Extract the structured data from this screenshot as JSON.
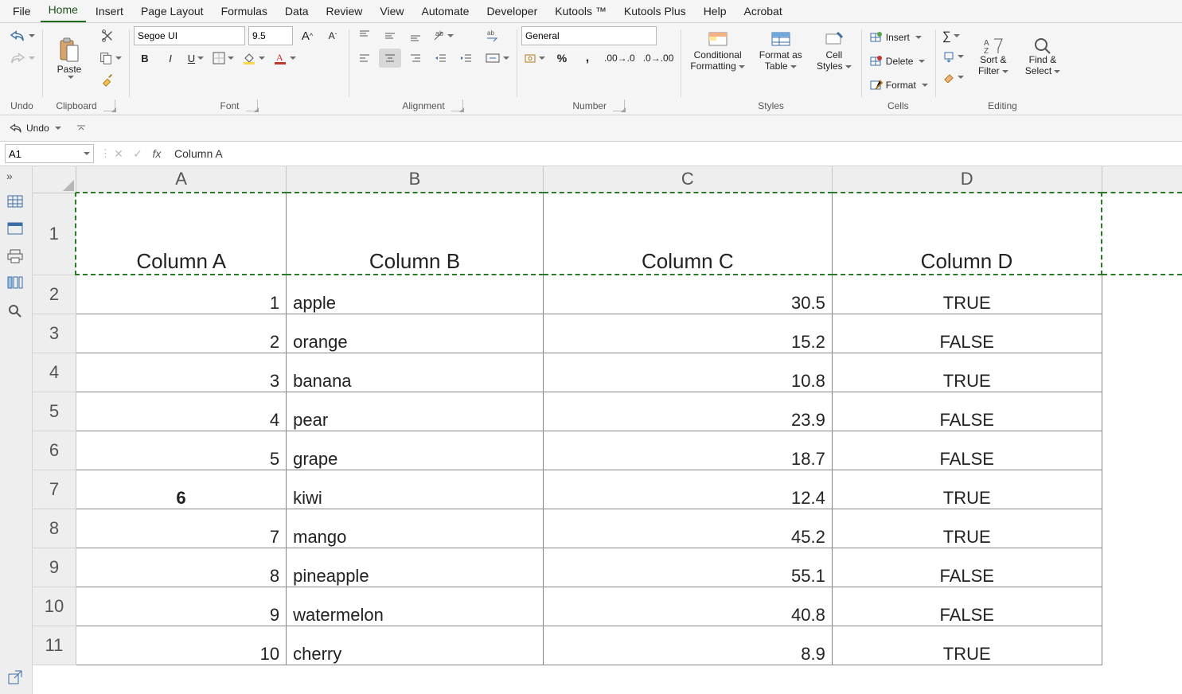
{
  "tabs": {
    "items": [
      "File",
      "Home",
      "Insert",
      "Page Layout",
      "Formulas",
      "Data",
      "Review",
      "View",
      "Automate",
      "Developer",
      "Kutools ™",
      "Kutools Plus",
      "Help",
      "Acrobat"
    ],
    "active_index": 1
  },
  "ribbon": {
    "undo_group": "Undo",
    "clipboard_group": "Clipboard",
    "paste_label": "Paste",
    "font_group": "Font",
    "font_name": "Segoe UI",
    "font_size": "9.5",
    "alignment_group": "Alignment",
    "number_group": "Number",
    "number_format": "General",
    "styles_group": "Styles",
    "conditional_label_1": "Conditional",
    "conditional_label_2": "Formatting",
    "format_as_label_1": "Format as",
    "format_as_label_2": "Table",
    "cell_styles_label_1": "Cell",
    "cell_styles_label_2": "Styles",
    "cells_group": "Cells",
    "insert_label": "Insert",
    "delete_label": "Delete",
    "format_label": "Format",
    "editing_group": "Editing",
    "sort_label_1": "Sort &",
    "sort_label_2": "Filter",
    "find_label_1": "Find &",
    "find_label_2": "Select",
    "undobar_label": "Undo"
  },
  "formula_bar": {
    "name_box": "A1",
    "formula": "Column A"
  },
  "sheet": {
    "col_letters": [
      "A",
      "B",
      "C",
      "D"
    ],
    "row_numbers": [
      "1",
      "2",
      "3",
      "4",
      "5",
      "6",
      "7",
      "8",
      "9",
      "10",
      "11"
    ],
    "headers": {
      "A": "Column A",
      "B": "Column B",
      "C": "Column C",
      "D": "Column D"
    },
    "rows": [
      {
        "A": "1",
        "B": "apple",
        "C": "30.5",
        "D": "TRUE"
      },
      {
        "A": "2",
        "B": "orange",
        "C": "15.2",
        "D": "FALSE"
      },
      {
        "A": "3",
        "B": "banana",
        "C": "10.8",
        "D": "TRUE"
      },
      {
        "A": "4",
        "B": "pear",
        "C": "23.9",
        "D": "FALSE"
      },
      {
        "A": "5",
        "B": "grape",
        "C": "18.7",
        "D": "FALSE"
      },
      {
        "A": "6",
        "B": "kiwi",
        "C": "12.4",
        "D": "TRUE"
      },
      {
        "A": "7",
        "B": "mango",
        "C": "45.2",
        "D": "TRUE"
      },
      {
        "A": "8",
        "B": "pineapple",
        "C": "55.1",
        "D": "FALSE"
      },
      {
        "A": "9",
        "B": "watermelon",
        "C": "40.8",
        "D": "FALSE"
      },
      {
        "A": "10",
        "B": "cherry",
        "C": "8.9",
        "D": "TRUE"
      }
    ]
  }
}
